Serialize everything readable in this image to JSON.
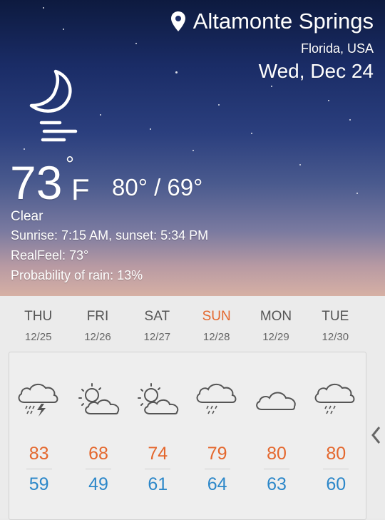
{
  "location": {
    "city": "Altamonte Springs",
    "region": "Florida, USA",
    "date": "Wed, Dec 24"
  },
  "current": {
    "temp": "73",
    "unit_symbol": "°",
    "unit": "F",
    "high_low": "80° / 69°",
    "condition": "Clear",
    "sun_times": "Sunrise: 7:15  AM, sunset: 5:34  PM",
    "real_feel": "RealFeel: 73°",
    "rain_probability": "Probability of rain: 13%",
    "icon": "moon-fog-icon"
  },
  "forecast": [
    {
      "day": "THU",
      "date": "12/25",
      "high": "83",
      "low": "59",
      "icon": "thunderstorm-icon",
      "highlight": false
    },
    {
      "day": "FRI",
      "date": "12/26",
      "high": "68",
      "low": "49",
      "icon": "partly-sunny-icon",
      "highlight": false
    },
    {
      "day": "SAT",
      "date": "12/27",
      "high": "74",
      "low": "61",
      "icon": "partly-sunny-icon",
      "highlight": false
    },
    {
      "day": "SUN",
      "date": "12/28",
      "high": "79",
      "low": "64",
      "icon": "rain-icon",
      "highlight": true
    },
    {
      "day": "MON",
      "date": "12/29",
      "high": "80",
      "low": "63",
      "icon": "cloudy-icon",
      "highlight": false
    },
    {
      "day": "TUE",
      "date": "12/30",
      "high": "80",
      "low": "60",
      "icon": "rain-icon",
      "highlight": false
    }
  ],
  "colors": {
    "high": "#e4672d",
    "low": "#2c87c9",
    "weekend_label": "#e4672d",
    "day_label": "#555555"
  }
}
